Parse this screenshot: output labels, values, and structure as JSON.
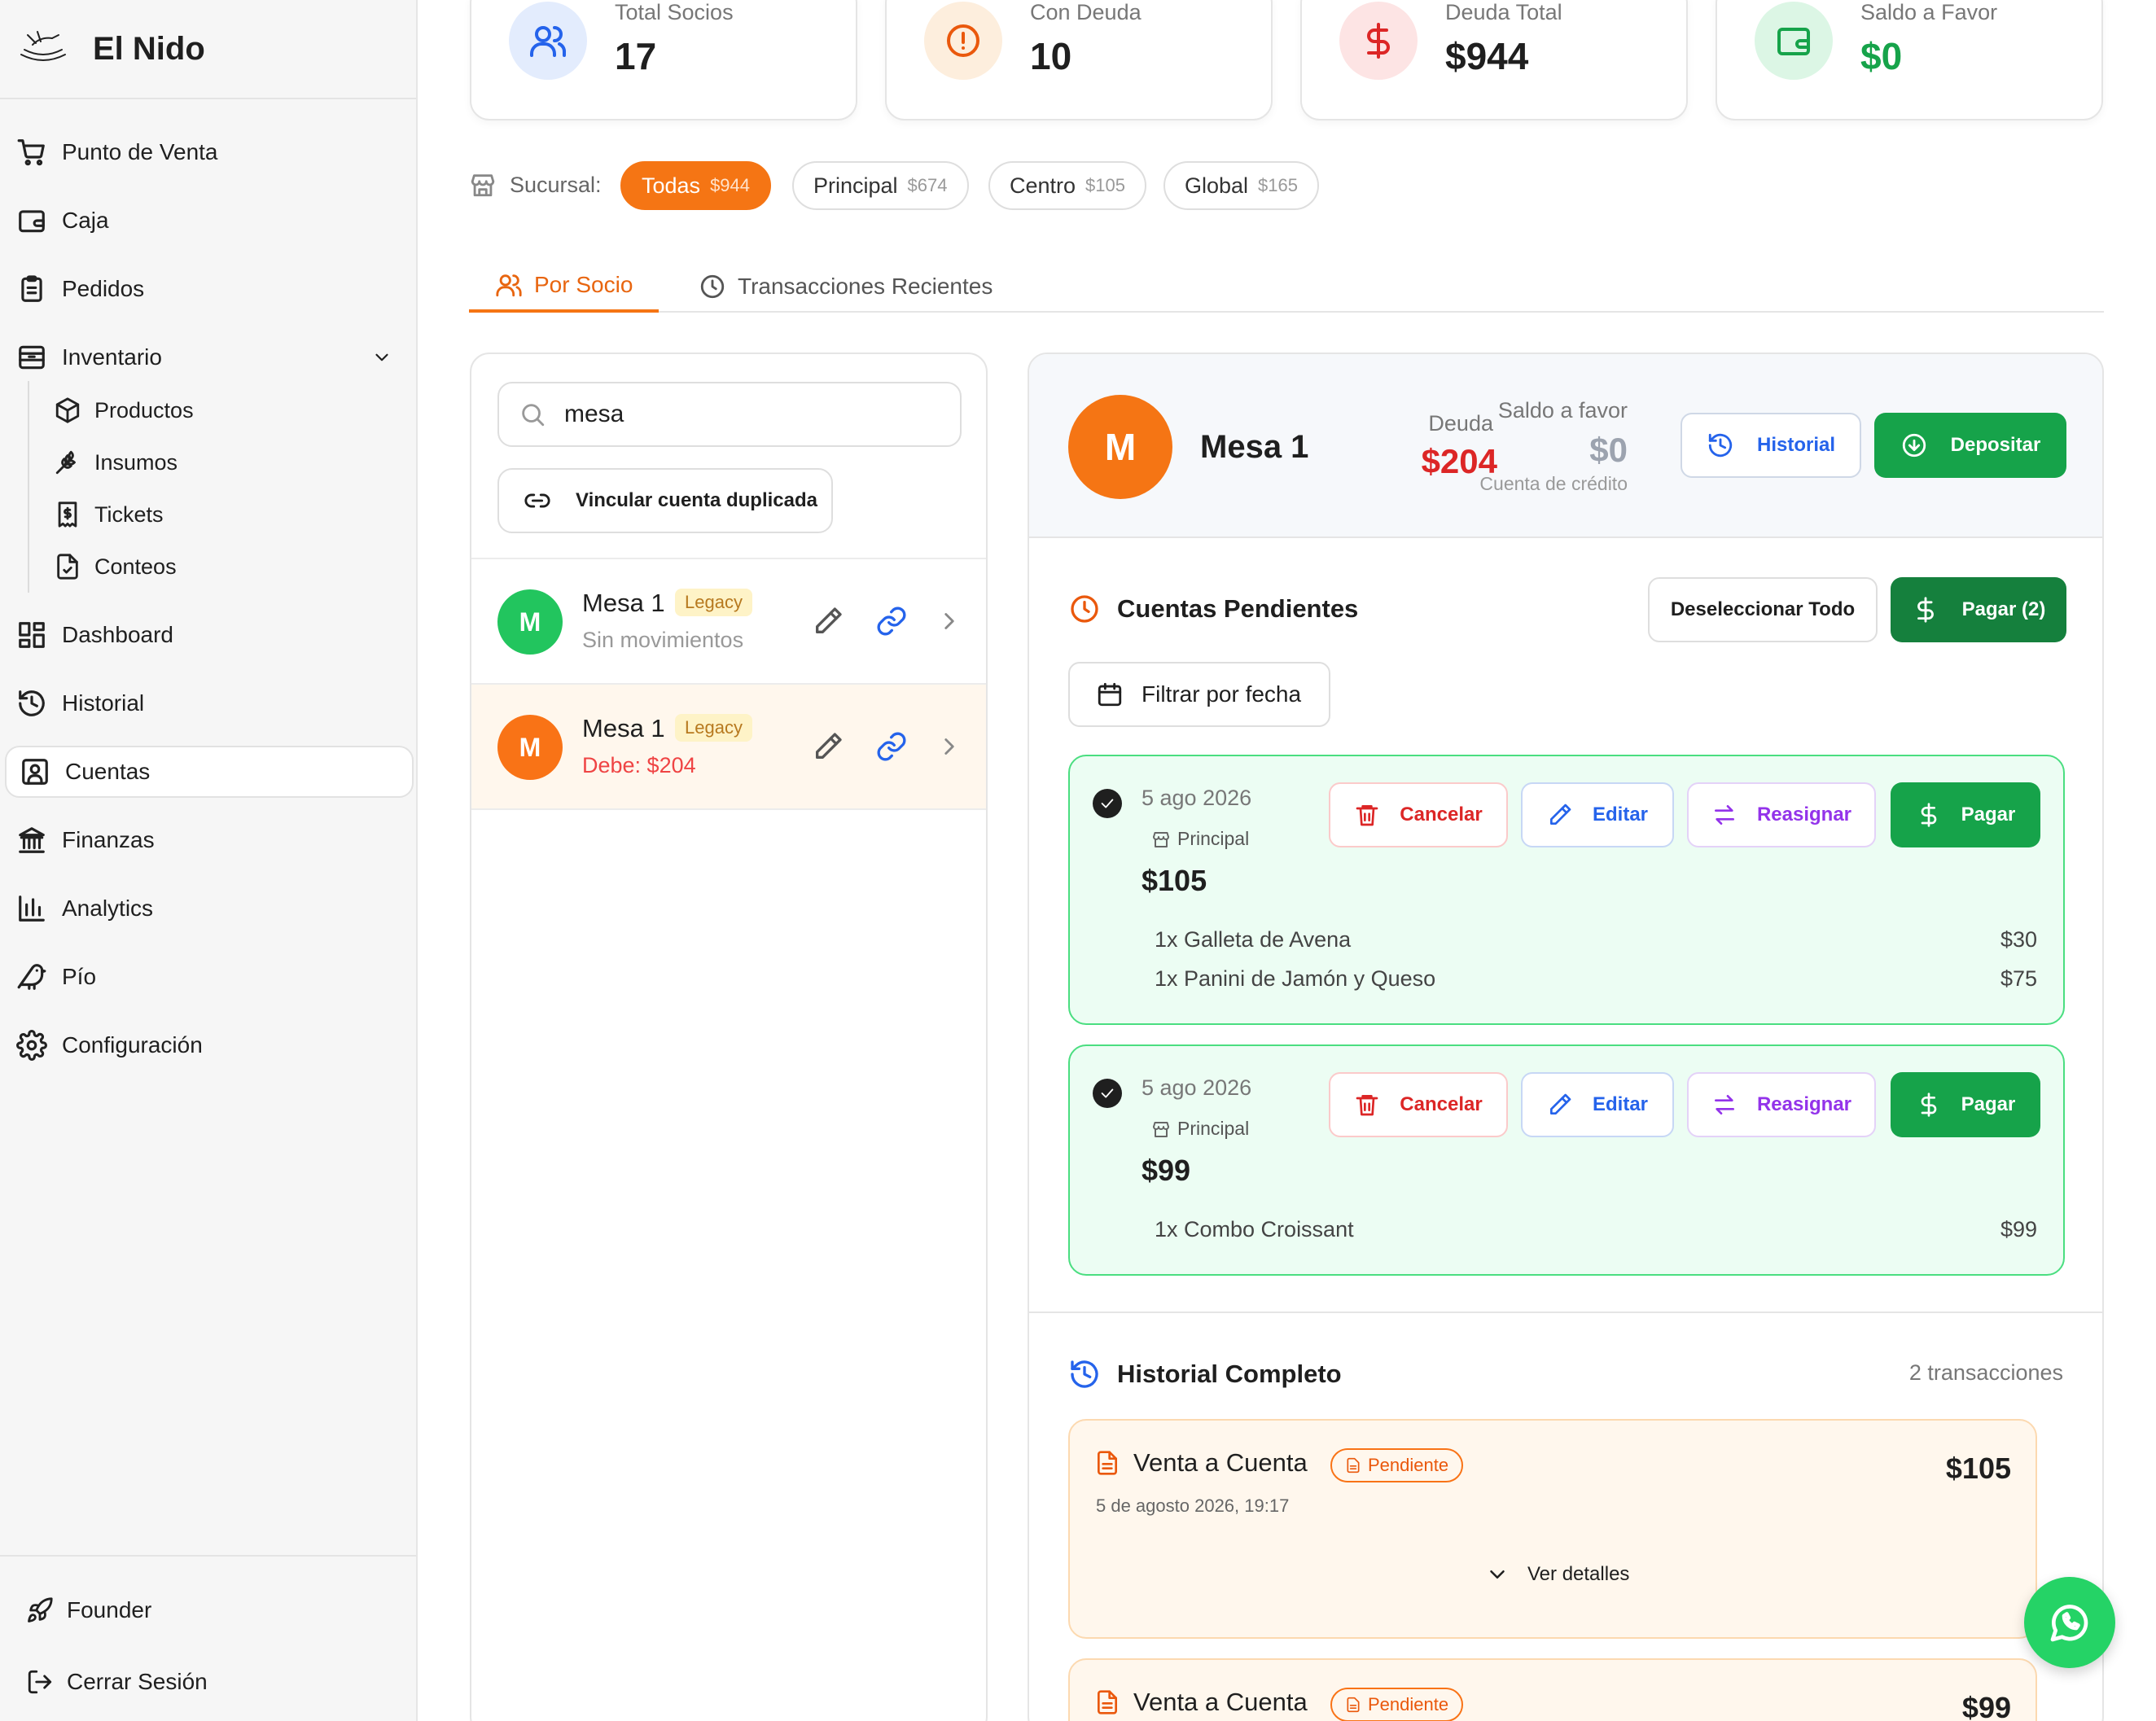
{
  "brand": {
    "name": "El Nido"
  },
  "nav": {
    "items": [
      {
        "label": "Punto de Venta",
        "icon": "cart-icon"
      },
      {
        "label": "Caja",
        "icon": "wallet-icon"
      },
      {
        "label": "Pedidos",
        "icon": "clipboard-icon"
      },
      {
        "label": "Inventario",
        "icon": "archive-icon"
      },
      {
        "label": "Dashboard",
        "icon": "dashboard-icon"
      },
      {
        "label": "Historial",
        "icon": "history-icon"
      },
      {
        "label": "Cuentas",
        "icon": "user-square-icon"
      },
      {
        "label": "Finanzas",
        "icon": "bank-icon"
      },
      {
        "label": "Analytics",
        "icon": "bar-chart-icon"
      },
      {
        "label": "Pío",
        "icon": "bird-icon"
      },
      {
        "label": "Configuración",
        "icon": "gear-icon"
      }
    ],
    "inventory_sub": [
      {
        "label": "Productos",
        "icon": "box-icon"
      },
      {
        "label": "Insumos",
        "icon": "wheat-icon"
      },
      {
        "label": "Tickets",
        "icon": "receipt-icon"
      },
      {
        "label": "Conteos",
        "icon": "file-check-icon"
      }
    ],
    "active": "Cuentas",
    "bottom": {
      "founder": "Founder",
      "logout": "Cerrar Sesión"
    }
  },
  "stats": [
    {
      "label": "Total Socios",
      "value": "17",
      "icon": "users-icon",
      "color": "#2563eb"
    },
    {
      "label": "Con Deuda",
      "value": "10",
      "icon": "alert-circle-icon",
      "color": "#ea580c"
    },
    {
      "label": "Deuda Total",
      "value": "$944",
      "icon": "dollar-icon",
      "color": "#dc2626"
    },
    {
      "label": "Saldo a Favor",
      "value": "$0",
      "icon": "wallet-icon",
      "color": "#16a34a"
    }
  ],
  "sucursal": {
    "label": "Sucursal:",
    "chips": [
      {
        "name": "Todas",
        "amount": "$944",
        "selected": true
      },
      {
        "name": "Principal",
        "amount": "$674",
        "selected": false
      },
      {
        "name": "Centro",
        "amount": "$105",
        "selected": false
      },
      {
        "name": "Global",
        "amount": "$165",
        "selected": false
      }
    ]
  },
  "tabs": [
    {
      "label": "Por Socio",
      "active": true
    },
    {
      "label": "Transacciones Recientes",
      "active": false
    }
  ],
  "list": {
    "search_value": "mesa",
    "link_button": "Vincular cuenta duplicada",
    "rows": [
      {
        "initial": "M",
        "name": "Mesa 1",
        "badge": "Legacy",
        "sub": "Sin movimientos",
        "avatar_color": "#22c55e"
      },
      {
        "initial": "M",
        "name": "Mesa 1",
        "badge": "Legacy",
        "sub": "Debe: $204",
        "avatar_color": "#f97316"
      }
    ]
  },
  "detail": {
    "initial": "M",
    "name": "Mesa 1",
    "deuda_label": "Deuda",
    "deuda_value": "$204",
    "saldo_label": "Saldo a favor",
    "saldo_value": "$0",
    "saldo_sub": "Cuenta de crédito",
    "historial_btn": "Historial",
    "depositar_btn": "Depositar",
    "pendientes_title": "Cuentas Pendientes",
    "deselect_btn": "Deseleccionar Todo",
    "pagar_sel_btn": "Pagar (2)",
    "filter_btn": "Filtrar por fecha",
    "card_actions": {
      "cancel": "Cancelar",
      "edit": "Editar",
      "reassign": "Reasignar",
      "pay": "Pagar"
    },
    "pending": [
      {
        "date": "5 ago 2026",
        "branch": "Principal",
        "amount": "$105",
        "items": [
          {
            "desc": "1x Galleta de Avena",
            "price": "$30"
          },
          {
            "desc": "1x Panini de Jamón y Queso",
            "price": "$75"
          }
        ]
      },
      {
        "date": "5 ago 2026",
        "branch": "Principal",
        "amount": "$99",
        "items": [
          {
            "desc": "1x Combo Croissant",
            "price": "$99"
          }
        ]
      }
    ],
    "history_title": "Historial Completo",
    "history_count": "2 transacciones",
    "history": [
      {
        "title": "Venta a Cuenta",
        "status": "Pendiente",
        "amount": "$105",
        "datetime": "5 de agosto 2026, 19:17",
        "more": "Ver detalles"
      },
      {
        "title": "Venta a Cuenta",
        "status": "Pendiente",
        "amount": "$99"
      }
    ]
  }
}
